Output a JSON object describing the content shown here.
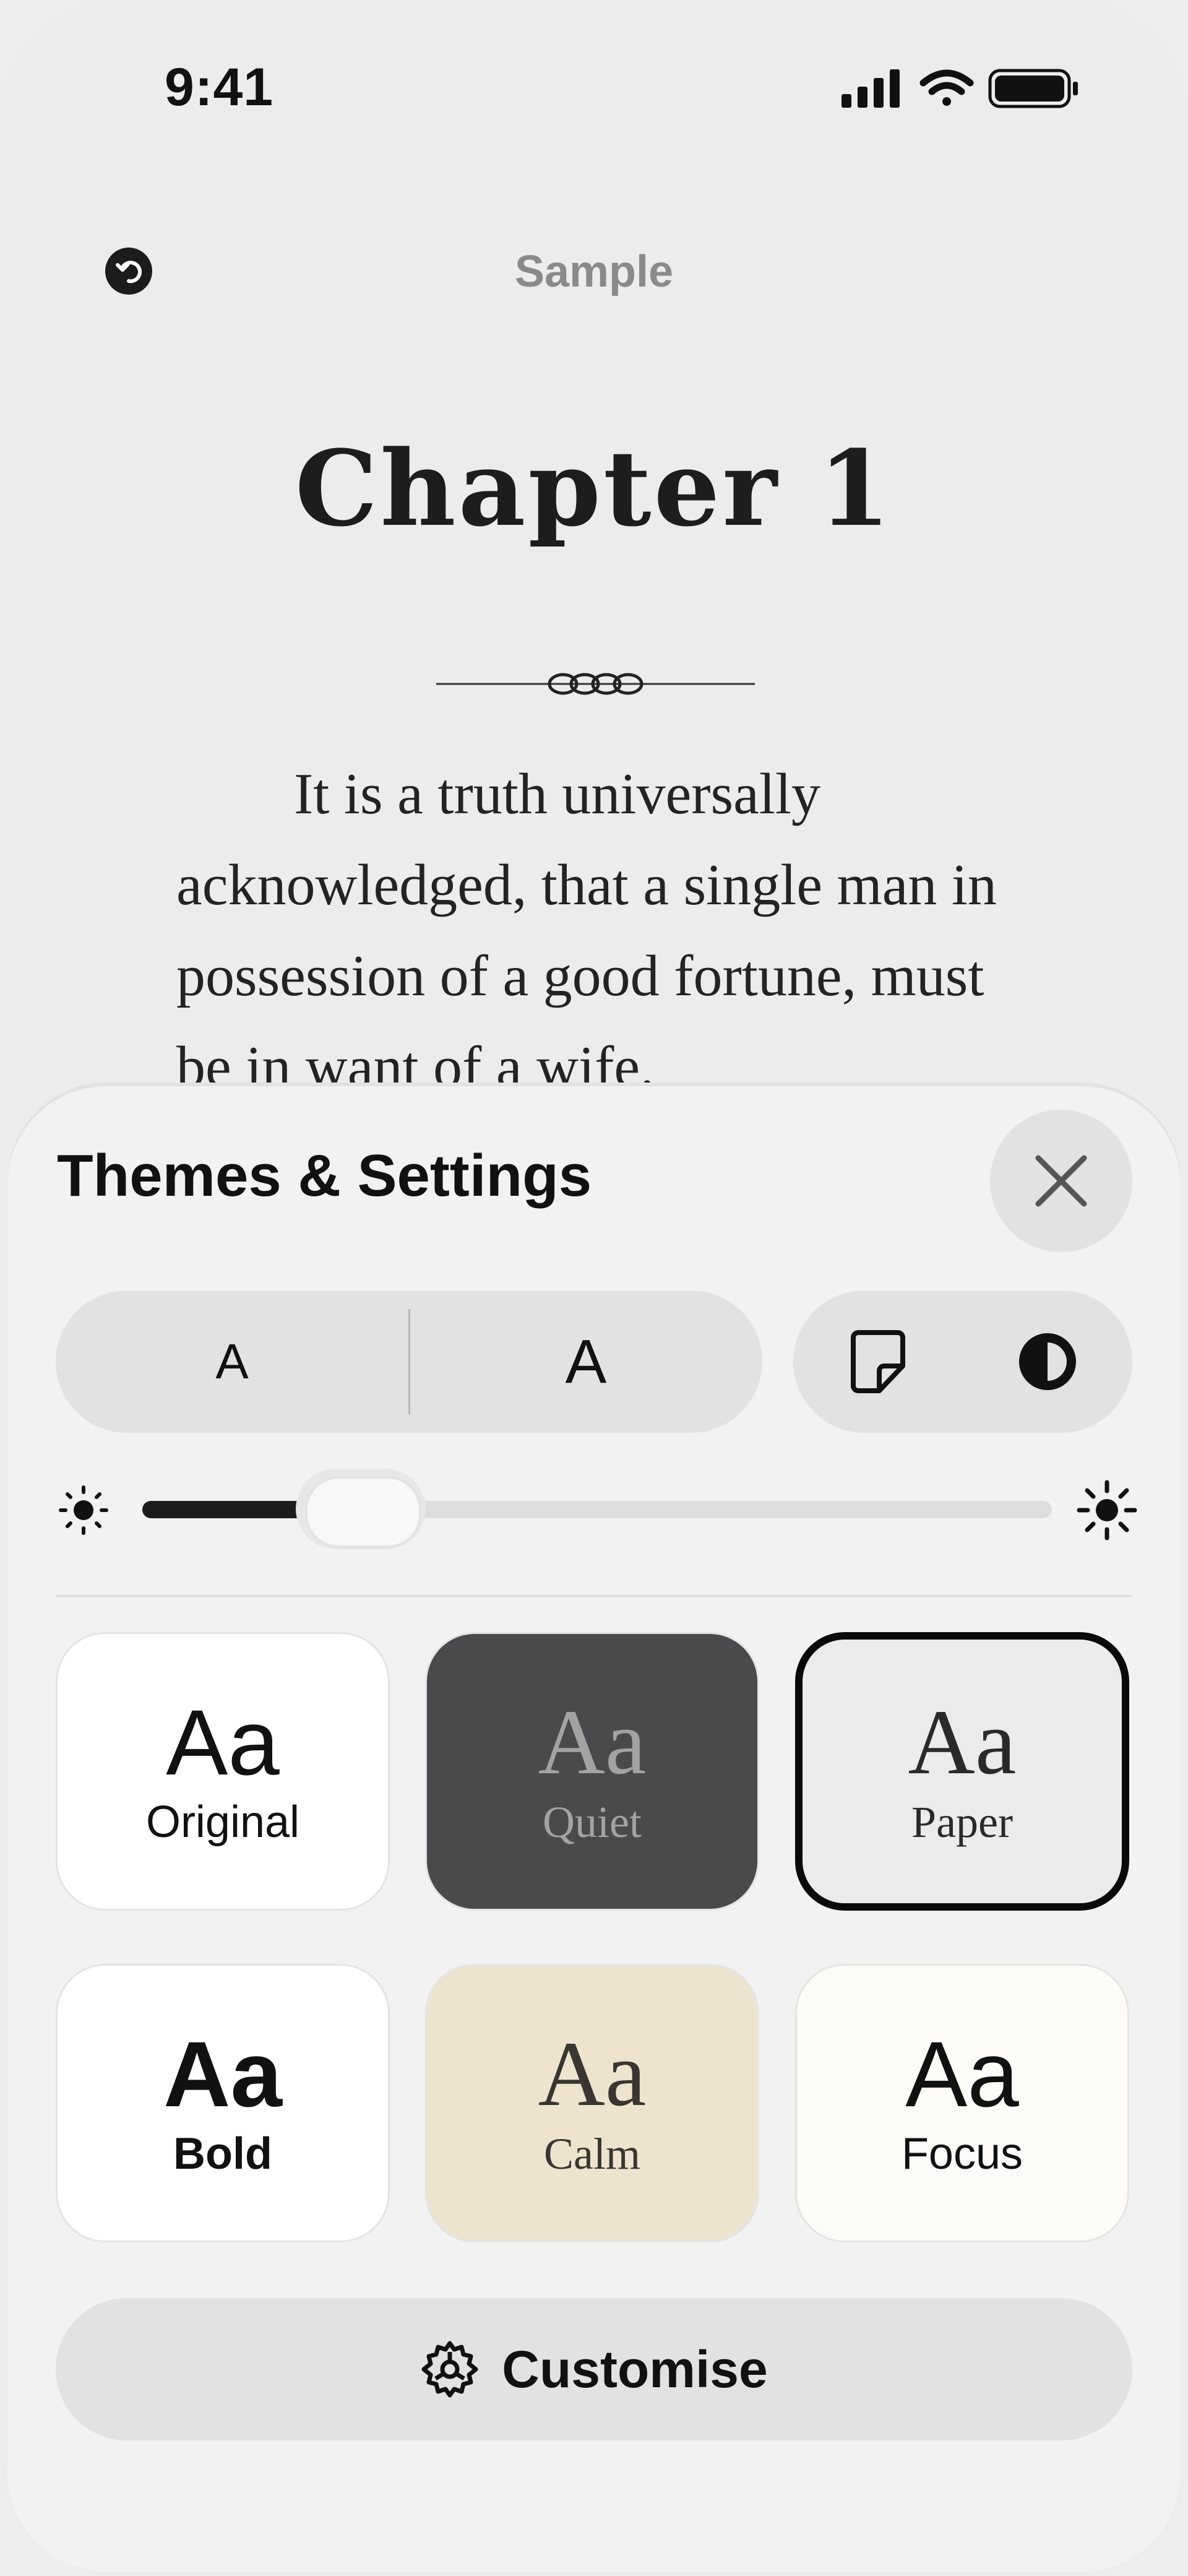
{
  "status_bar": {
    "time": "9:41"
  },
  "reader": {
    "book_title": "Sample",
    "chapter_title": "Chapter 1",
    "body_text": "It is a truth universally acknowledged, that a single man in possession of a good fortune, must be in want of a wife."
  },
  "sheet": {
    "title": "Themes & Settings",
    "font_size_small_label": "A",
    "font_size_large_label": "A",
    "brightness_level": 0.24,
    "themes": [
      {
        "label": "Original",
        "aa": "Aa",
        "bg": "#ffffff",
        "fg": "#111111",
        "selected": false
      },
      {
        "label": "Quiet",
        "aa": "Aa",
        "bg": "#4a4a4c",
        "fg": "#a3a3a3",
        "selected": false
      },
      {
        "label": "Paper",
        "aa": "Aa",
        "bg": "#ebebeb",
        "fg": "#2a2a2a",
        "selected": true
      },
      {
        "label": "Bold",
        "aa": "Aa",
        "bg": "#ffffff",
        "fg": "#111111",
        "selected": false
      },
      {
        "label": "Calm",
        "aa": "Aa",
        "bg": "#ede3cf",
        "fg": "#3a3530",
        "selected": false
      },
      {
        "label": "Focus",
        "aa": "Aa",
        "bg": "#fcfbf7",
        "fg": "#111111",
        "selected": false
      }
    ],
    "customise_label": "Customise"
  },
  "icons": [
    "signal-icon",
    "wifi-icon",
    "battery-icon",
    "back-icon",
    "close-icon",
    "page-view-icon",
    "contrast-icon",
    "brightness-low-icon",
    "brightness-high-icon",
    "gear-icon"
  ]
}
